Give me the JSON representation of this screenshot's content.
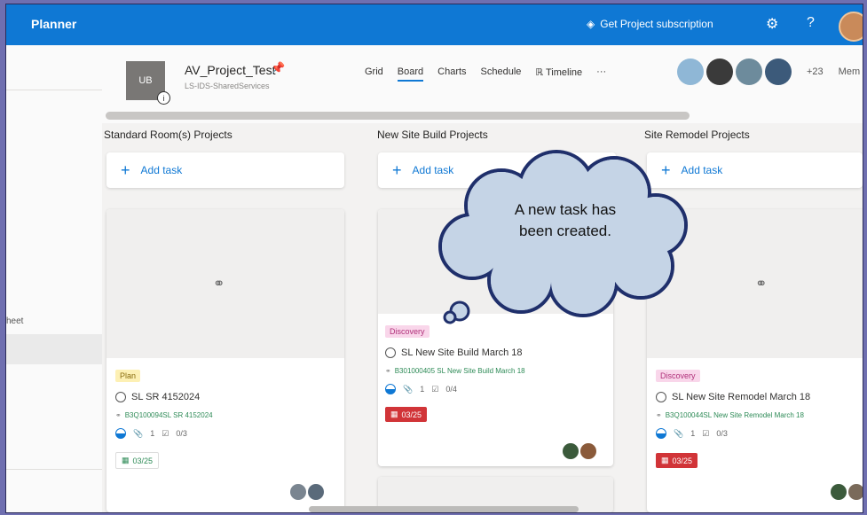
{
  "app": {
    "title": "Planner",
    "subscription_label": "Get Project subscription",
    "settings_icon": "gear-icon",
    "help_label": "?"
  },
  "plan": {
    "initials": "UB",
    "name": "AV_Project_Test",
    "group": "LS-IDS-SharedServices",
    "info_label": "i"
  },
  "views": [
    "Grid",
    "Board",
    "Charts",
    "Schedule",
    "Timeline",
    "···"
  ],
  "active_view": "Board",
  "members": {
    "extra_count": "+23",
    "label": "Mem"
  },
  "left_nav": {
    "fragment": "heet"
  },
  "buckets": [
    {
      "title": "Standard Room(s) Projects",
      "add_task": "Add task",
      "card": {
        "label": "Plan",
        "label_type": "plan",
        "task": "SL SR 4152024",
        "link": "B3Q100094SL SR 4152024",
        "checklist": "0/3",
        "attachments": "1",
        "due": "03/25"
      }
    },
    {
      "title": "New Site Build Projects",
      "add_task": "Add task",
      "card": {
        "label": "Discovery",
        "label_type": "disc",
        "task": "SL New Site Build March 18",
        "link": "B301000405 SL New Site Build March 18",
        "checklist": "0/4",
        "attachments": "1",
        "due": "03/25"
      }
    },
    {
      "title": "Site Remodel Projects",
      "add_task": "Add task",
      "card": {
        "label": "Discovery",
        "label_type": "disc",
        "task": "SL New Site Remodel March 18",
        "link": "B3Q100044SL New Site Remodel March 18",
        "checklist": "0/3",
        "attachments": "1",
        "due": "03/25"
      }
    }
  ],
  "callout": {
    "text": "A new task has been created."
  },
  "colors": {
    "topbar": "#0f78d4",
    "due": "#d13438",
    "accent": "#0f78d4"
  }
}
